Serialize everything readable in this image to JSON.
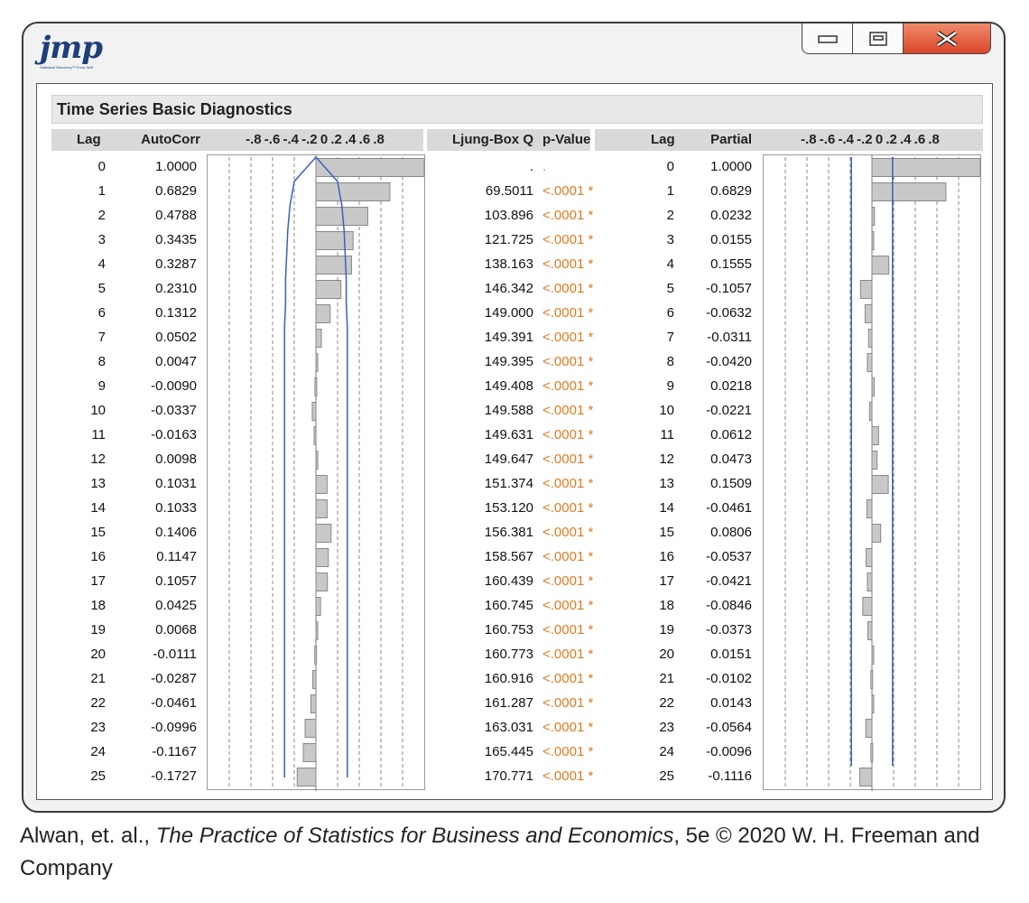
{
  "window": {
    "logo_text": "jmp",
    "logo_subtext": "Statistical Discovery™ From SAS",
    "buttons": [
      "minimize",
      "maximize",
      "close"
    ]
  },
  "report": {
    "title": "Time Series Basic Diagnostics",
    "headers": {
      "lag": "Lag",
      "autocorr": "AutoCorr",
      "axis_ticks": "-.8 -.6 -.4 -.2  0  .2  .4  .6  .8",
      "ljung": "Ljung-Box Q",
      "pvalue": "p-Value",
      "lag2": "Lag",
      "partial": "Partial",
      "axis_ticks2": "-.8 -.6 -.4 -.2  0  .2  .4  .6  .8"
    },
    "rows": [
      {
        "lag": "0",
        "acf": "1.0000",
        "q": ".",
        "p": ".",
        "plag": "0",
        "pacf": "1.0000"
      },
      {
        "lag": "1",
        "acf": "0.6829",
        "q": "69.5011",
        "p": "<.0001 *",
        "plag": "1",
        "pacf": "0.6829"
      },
      {
        "lag": "2",
        "acf": "0.4788",
        "q": "103.896",
        "p": "<.0001 *",
        "plag": "2",
        "pacf": "0.0232"
      },
      {
        "lag": "3",
        "acf": "0.3435",
        "q": "121.725",
        "p": "<.0001 *",
        "plag": "3",
        "pacf": "0.0155"
      },
      {
        "lag": "4",
        "acf": "0.3287",
        "q": "138.163",
        "p": "<.0001 *",
        "plag": "4",
        "pacf": "0.1555"
      },
      {
        "lag": "5",
        "acf": "0.2310",
        "q": "146.342",
        "p": "<.0001 *",
        "plag": "5",
        "pacf": "-0.1057"
      },
      {
        "lag": "6",
        "acf": "0.1312",
        "q": "149.000",
        "p": "<.0001 *",
        "plag": "6",
        "pacf": "-0.0632"
      },
      {
        "lag": "7",
        "acf": "0.0502",
        "q": "149.391",
        "p": "<.0001 *",
        "plag": "7",
        "pacf": "-0.0311"
      },
      {
        "lag": "8",
        "acf": "0.0047",
        "q": "149.395",
        "p": "<.0001 *",
        "plag": "8",
        "pacf": "-0.0420"
      },
      {
        "lag": "9",
        "acf": "-0.0090",
        "q": "149.408",
        "p": "<.0001 *",
        "plag": "9",
        "pacf": "0.0218"
      },
      {
        "lag": "10",
        "acf": "-0.0337",
        "q": "149.588",
        "p": "<.0001 *",
        "plag": "10",
        "pacf": "-0.0221"
      },
      {
        "lag": "11",
        "acf": "-0.0163",
        "q": "149.631",
        "p": "<.0001 *",
        "plag": "11",
        "pacf": "0.0612"
      },
      {
        "lag": "12",
        "acf": "0.0098",
        "q": "149.647",
        "p": "<.0001 *",
        "plag": "12",
        "pacf": "0.0473"
      },
      {
        "lag": "13",
        "acf": "0.1031",
        "q": "151.374",
        "p": "<.0001 *",
        "plag": "13",
        "pacf": "0.1509"
      },
      {
        "lag": "14",
        "acf": "0.1033",
        "q": "153.120",
        "p": "<.0001 *",
        "plag": "14",
        "pacf": "-0.0461"
      },
      {
        "lag": "15",
        "acf": "0.1406",
        "q": "156.381",
        "p": "<.0001 *",
        "plag": "15",
        "pacf": "0.0806"
      },
      {
        "lag": "16",
        "acf": "0.1147",
        "q": "158.567",
        "p": "<.0001 *",
        "plag": "16",
        "pacf": "-0.0537"
      },
      {
        "lag": "17",
        "acf": "0.1057",
        "q": "160.439",
        "p": "<.0001 *",
        "plag": "17",
        "pacf": "-0.0421"
      },
      {
        "lag": "18",
        "acf": "0.0425",
        "q": "160.745",
        "p": "<.0001 *",
        "plag": "18",
        "pacf": "-0.0846"
      },
      {
        "lag": "19",
        "acf": "0.0068",
        "q": "160.753",
        "p": "<.0001 *",
        "plag": "19",
        "pacf": "-0.0373"
      },
      {
        "lag": "20",
        "acf": "-0.0111",
        "q": "160.773",
        "p": "<.0001 *",
        "plag": "20",
        "pacf": "0.0151"
      },
      {
        "lag": "21",
        "acf": "-0.0287",
        "q": "160.916",
        "p": "<.0001 *",
        "plag": "21",
        "pacf": "-0.0102"
      },
      {
        "lag": "22",
        "acf": "-0.0461",
        "q": "161.287",
        "p": "<.0001 *",
        "plag": "22",
        "pacf": "0.0143"
      },
      {
        "lag": "23",
        "acf": "-0.0996",
        "q": "163.031",
        "p": "<.0001 *",
        "plag": "23",
        "pacf": "-0.0564"
      },
      {
        "lag": "24",
        "acf": "-0.1167",
        "q": "165.445",
        "p": "<.0001 *",
        "plag": "24",
        "pacf": "-0.0096"
      },
      {
        "lag": "25",
        "acf": "-0.1727",
        "q": "170.771",
        "p": "<.0001 *",
        "plag": "25",
        "pacf": "-0.1116"
      }
    ]
  },
  "chart_data": [
    {
      "type": "bar",
      "xlabel": "AutoCorr",
      "xlim": [
        -1,
        1
      ],
      "ticks": [
        -0.8,
        -0.6,
        -0.4,
        -0.2,
        0,
        0.2,
        0.4,
        0.6,
        0.8
      ],
      "categories": [
        "0",
        "1",
        "2",
        "3",
        "4",
        "5",
        "6",
        "7",
        "8",
        "9",
        "10",
        "11",
        "12",
        "13",
        "14",
        "15",
        "16",
        "17",
        "18",
        "19",
        "20",
        "21",
        "22",
        "23",
        "24",
        "25"
      ],
      "values": [
        1.0,
        0.6829,
        0.4788,
        0.3435,
        0.3287,
        0.231,
        0.1312,
        0.0502,
        0.0047,
        -0.009,
        -0.0337,
        -0.0163,
        0.0098,
        0.1031,
        0.1033,
        0.1406,
        0.1147,
        0.1057,
        0.0425,
        0.0068,
        -0.0111,
        -0.0287,
        -0.0461,
        -0.0996,
        -0.1167,
        -0.1727
      ],
      "bounds_approx": [
        0.0,
        0.2,
        0.24,
        0.26,
        0.27,
        0.28,
        0.28,
        0.29,
        0.29,
        0.29,
        0.29,
        0.29,
        0.29,
        0.29,
        0.29,
        0.29,
        0.29,
        0.29,
        0.29,
        0.29,
        0.29,
        0.29,
        0.29,
        0.29,
        0.29,
        0.29
      ],
      "bar_color": "#c8c8c8",
      "bound_color": "#3b5fc0"
    },
    {
      "type": "bar",
      "xlabel": "Partial",
      "xlim": [
        -1,
        1
      ],
      "ticks": [
        -0.8,
        -0.6,
        -0.4,
        -0.2,
        0,
        0.2,
        0.4,
        0.6,
        0.8
      ],
      "categories": [
        "0",
        "1",
        "2",
        "3",
        "4",
        "5",
        "6",
        "7",
        "8",
        "9",
        "10",
        "11",
        "12",
        "13",
        "14",
        "15",
        "16",
        "17",
        "18",
        "19",
        "20",
        "21",
        "22",
        "23",
        "24",
        "25"
      ],
      "values": [
        1.0,
        0.6829,
        0.0232,
        0.0155,
        0.1555,
        -0.1057,
        -0.0632,
        -0.0311,
        -0.042,
        0.0218,
        -0.0221,
        0.0612,
        0.0473,
        0.1509,
        -0.0461,
        0.0806,
        -0.0537,
        -0.0421,
        -0.0846,
        -0.0373,
        0.0151,
        -0.0102,
        0.0143,
        -0.0564,
        -0.0096,
        -0.1116
      ],
      "bound_approx": 0.19,
      "bar_color": "#c8c8c8",
      "bound_color": "#3b5fc0"
    }
  ],
  "caption": {
    "prefix": "Alwan, et. al., ",
    "title": "The Practice of Statistics for Business and Economics",
    "suffix": ", 5e © 2020 W. H. Freeman and Company"
  }
}
